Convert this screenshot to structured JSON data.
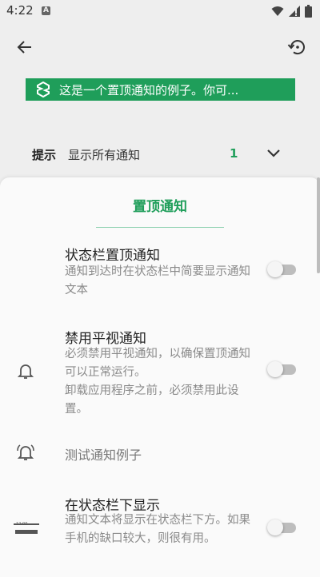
{
  "status_bar": {
    "time": "4:22",
    "notification_badge": "A",
    "icons": [
      "wifi-icon",
      "signal-icon",
      "battery-icon"
    ]
  },
  "toolbar": {
    "back_icon": "arrow-left-icon",
    "history_icon": "history-restore-icon"
  },
  "banner": {
    "icon": "app-logo-icon",
    "text": "这是一个置顶通知的例子。你可...",
    "background": "#1f9e5a"
  },
  "hint": {
    "label": "提示",
    "value": "显示所有通知",
    "count": "1",
    "chevron_icon": "chevron-down-icon"
  },
  "sheet": {
    "title": "置顶通知",
    "accent": "#1f9e5a",
    "items": [
      {
        "title": "状态栏置顶通知",
        "description": "通知到达时在状态栏中简要显示通知文本",
        "toggle_on": false
      },
      {
        "icon": "bell-icon",
        "title": "禁用平视通知",
        "description": "必须禁用平视通知，以确保置顶通知可以正常运行。",
        "description2": "卸载应用程序之前，必须禁用此设置。",
        "toggle_on": false
      },
      {
        "icon": "ringing-bell-icon",
        "title": "测试通知例子"
      },
      {
        "icon": "statusbar-preview-icon",
        "icon_text": "12:00",
        "title": "在状态栏下显示",
        "description": "通知文本将显示在状态栏下方。如果手机的缺口较大，则很有用。",
        "toggle_on": false
      }
    ]
  }
}
